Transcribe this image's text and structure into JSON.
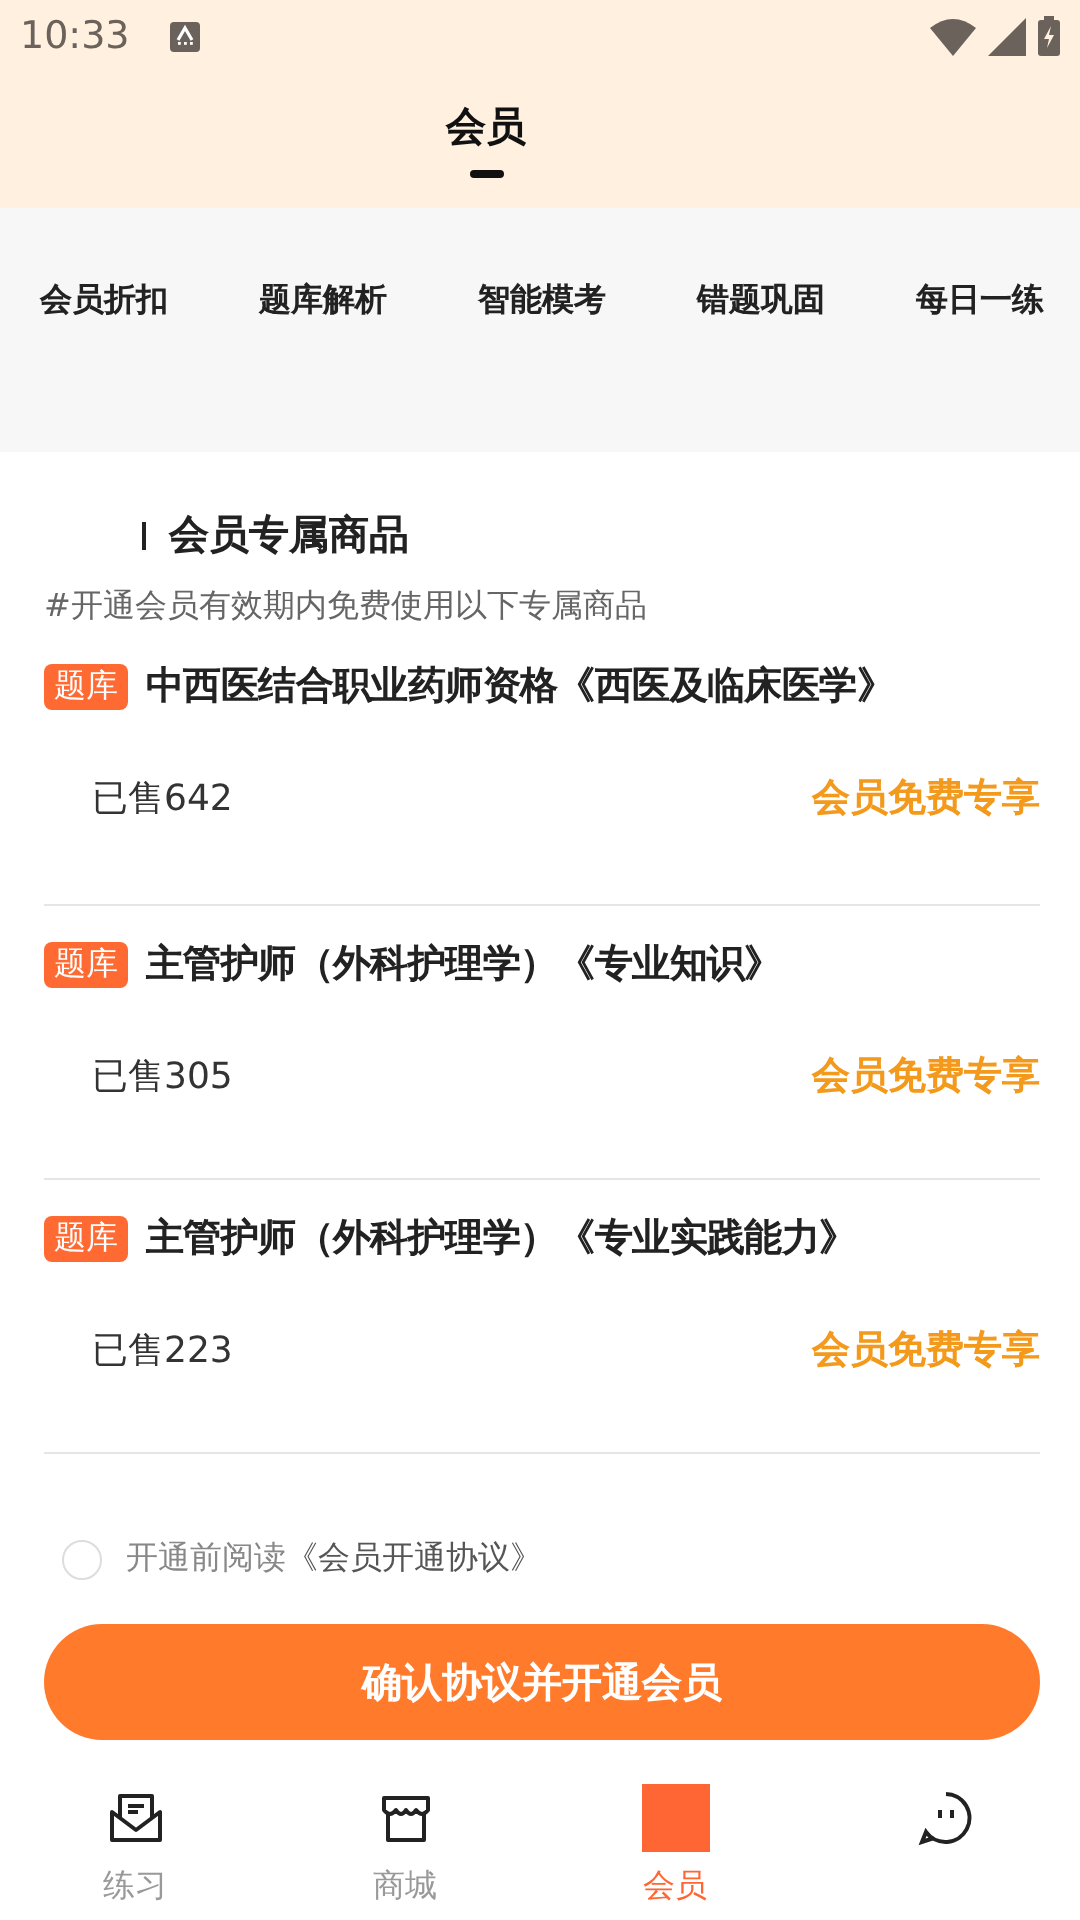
{
  "status_bar": {
    "time": "10:33"
  },
  "header": {
    "title": "会员"
  },
  "features": [
    {
      "label": "会员折扣"
    },
    {
      "label": "题库解析"
    },
    {
      "label": "智能模考"
    },
    {
      "label": "错题巩固"
    },
    {
      "label": "每日一练"
    }
  ],
  "section": {
    "title": "会员专属商品",
    "subtitle": "#开通会员有效期内免费使用以下专属商品"
  },
  "products": [
    {
      "tag": "题库",
      "name": "中西医结合职业药师资格《西医及临床医学》",
      "sold": "已售642",
      "offer": "会员免费专享"
    },
    {
      "tag": "题库",
      "name": "主管护师（外科护理学）《专业知识》",
      "sold": "已售305",
      "offer": "会员免费专享"
    },
    {
      "tag": "题库",
      "name": "主管护师（外科护理学）《专业实践能力》",
      "sold": "已售223",
      "offer": "会员免费专享"
    }
  ],
  "agreement": {
    "checked": false,
    "prefix": "开通前阅读",
    "link": "《会员开通协议》"
  },
  "confirm_button": "确认协议并开通会员",
  "nav": [
    {
      "kind": "practice",
      "label": "练习",
      "selected": false
    },
    {
      "kind": "store",
      "label": "商城",
      "selected": false
    },
    {
      "kind": "member",
      "label": "会员",
      "selected": true
    },
    {
      "kind": "chat",
      "selected": false
    }
  ]
}
